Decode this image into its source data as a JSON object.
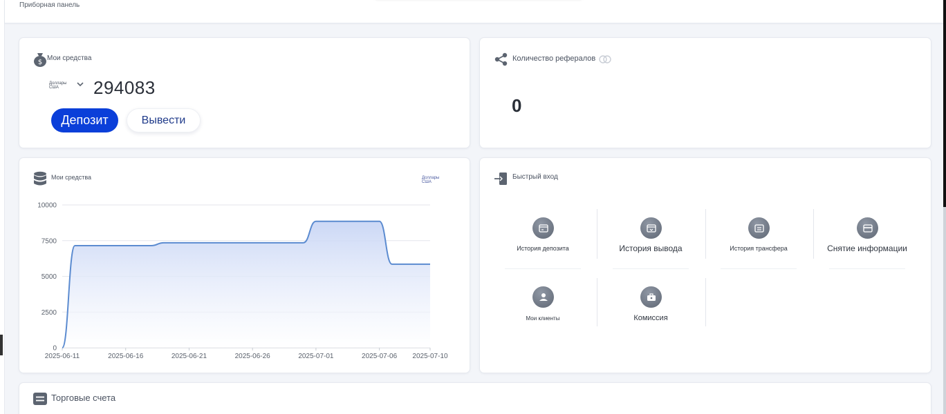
{
  "header": {
    "breadcrumb": "Приборная панель"
  },
  "funds_card": {
    "title": "Мои средства",
    "currency_line1": "Доллары",
    "currency_line2": "США",
    "balance": "294083",
    "deposit_label": "Депозит",
    "withdraw_label": "Вывести"
  },
  "referrals_card": {
    "title": "Количество рефералов",
    "count": "0"
  },
  "chart_card": {
    "title": "Мои средства",
    "currency_line1": "Доллары",
    "currency_line2": "США"
  },
  "chart_data": {
    "type": "area",
    "x": [
      "2025-06-11",
      "2025-06-12",
      "2025-06-13",
      "2025-06-14",
      "2025-06-15",
      "2025-06-16",
      "2025-06-17",
      "2025-06-18",
      "2025-06-19",
      "2025-06-20",
      "2025-06-21",
      "2025-06-22",
      "2025-06-23",
      "2025-06-24",
      "2025-06-25",
      "2025-06-26",
      "2025-06-27",
      "2025-06-28",
      "2025-06-29",
      "2025-06-30",
      "2025-07-01",
      "2025-07-02",
      "2025-07-03",
      "2025-07-04",
      "2025-07-05",
      "2025-07-06",
      "2025-07-07",
      "2025-07-08",
      "2025-07-09",
      "2025-07-10"
    ],
    "values": [
      0,
      7150,
      7150,
      7150,
      7150,
      7150,
      7150,
      7150,
      7350,
      7350,
      7350,
      7350,
      7350,
      7350,
      7350,
      7350,
      7350,
      7350,
      7350,
      7350,
      8850,
      8850,
      8850,
      8850,
      8850,
      8850,
      5850,
      5850,
      5850,
      5850
    ],
    "x_tick_labels": [
      "2025-06-11",
      "2025-06-16",
      "2025-06-21",
      "2025-06-26",
      "2025-07-01",
      "2025-07-06",
      "2025-07-10"
    ],
    "y_tick_labels": [
      "0",
      "2500",
      "5000",
      "7500",
      "10000"
    ],
    "ylim": [
      0,
      10000
    ],
    "grid": true,
    "line_color": "#5b8bd0",
    "fill_color_top": "#c9d6f5",
    "fill_color_bottom": "#ffffff"
  },
  "quick_card": {
    "title": "Быстрый вход",
    "items": [
      {
        "label": "История депозита",
        "icon": "deposit-history-icon"
      },
      {
        "label": "История вывода",
        "icon": "withdraw-history-icon"
      },
      {
        "label": "История трансфера",
        "icon": "transfer-history-icon"
      },
      {
        "label": "Снятие информации",
        "icon": "withdraw-info-icon"
      },
      {
        "label": "Мои клиенты",
        "icon": "clients-icon"
      },
      {
        "label": "Комиссия",
        "icon": "commission-icon"
      }
    ]
  },
  "accounts_card": {
    "title": "Торговые счета"
  },
  "colors": {
    "primary_button": "#0b3fd9",
    "withdraw_text": "#1f3a8a",
    "icon_gray": "#6b7380"
  }
}
